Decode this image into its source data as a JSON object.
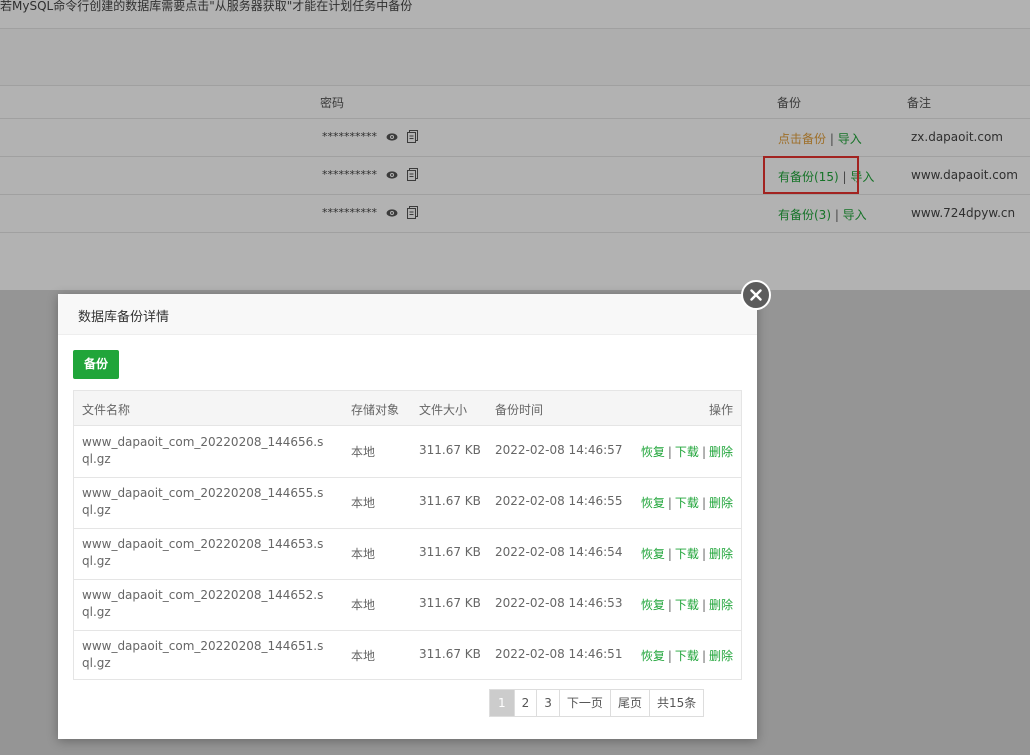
{
  "notice": "若MySQL命令行创建的数据库需要点击\"从服务器获取\"才能在计划任务中备份",
  "table_header": {
    "password": "密码",
    "backup": "备份",
    "note": "备注"
  },
  "db_rows": [
    {
      "password": "**********",
      "backup_label": "点击备份",
      "backup_status": "none",
      "import_label": "导入",
      "note": "zx.dapaoit.com"
    },
    {
      "password": "**********",
      "backup_label": "有备份(15)",
      "backup_status": "has",
      "import_label": "导入",
      "note": "www.dapaoit.com"
    },
    {
      "password": "**********",
      "backup_label": "有备份(3)",
      "backup_status": "has",
      "import_label": "导入",
      "note": "www.724dpyw.cn"
    }
  ],
  "dialog": {
    "title": "数据库备份详情",
    "backup_button": "备份",
    "columns": {
      "filename": "文件名称",
      "storage": "存储对象",
      "size": "文件大小",
      "time": "备份时间",
      "actions": "操作"
    },
    "files": [
      {
        "filename": "www_dapaoit_com_20220208_144656.sql.gz",
        "storage": "本地",
        "size": "311.67 KB",
        "time": "2022-02-08 14:46:57"
      },
      {
        "filename": "www_dapaoit_com_20220208_144655.sql.gz",
        "storage": "本地",
        "size": "311.67 KB",
        "time": "2022-02-08 14:46:55"
      },
      {
        "filename": "www_dapaoit_com_20220208_144653.sql.gz",
        "storage": "本地",
        "size": "311.67 KB",
        "time": "2022-02-08 14:46:54"
      },
      {
        "filename": "www_dapaoit_com_20220208_144652.sql.gz",
        "storage": "本地",
        "size": "311.67 KB",
        "time": "2022-02-08 14:46:53"
      },
      {
        "filename": "www_dapaoit_com_20220208_144651.sql.gz",
        "storage": "本地",
        "size": "311.67 KB",
        "time": "2022-02-08 14:46:51"
      }
    ],
    "actions": {
      "restore": "恢复",
      "download": "下载",
      "delete": "删除",
      "separator": "|"
    },
    "pager": {
      "pages": [
        "1",
        "2",
        "3"
      ],
      "current": "1",
      "next": "下一页",
      "last": "尾页",
      "total": "共15条"
    }
  },
  "colors": {
    "green": "#20a53a",
    "orange": "#e2a03c",
    "highlight": "#e8332f"
  }
}
